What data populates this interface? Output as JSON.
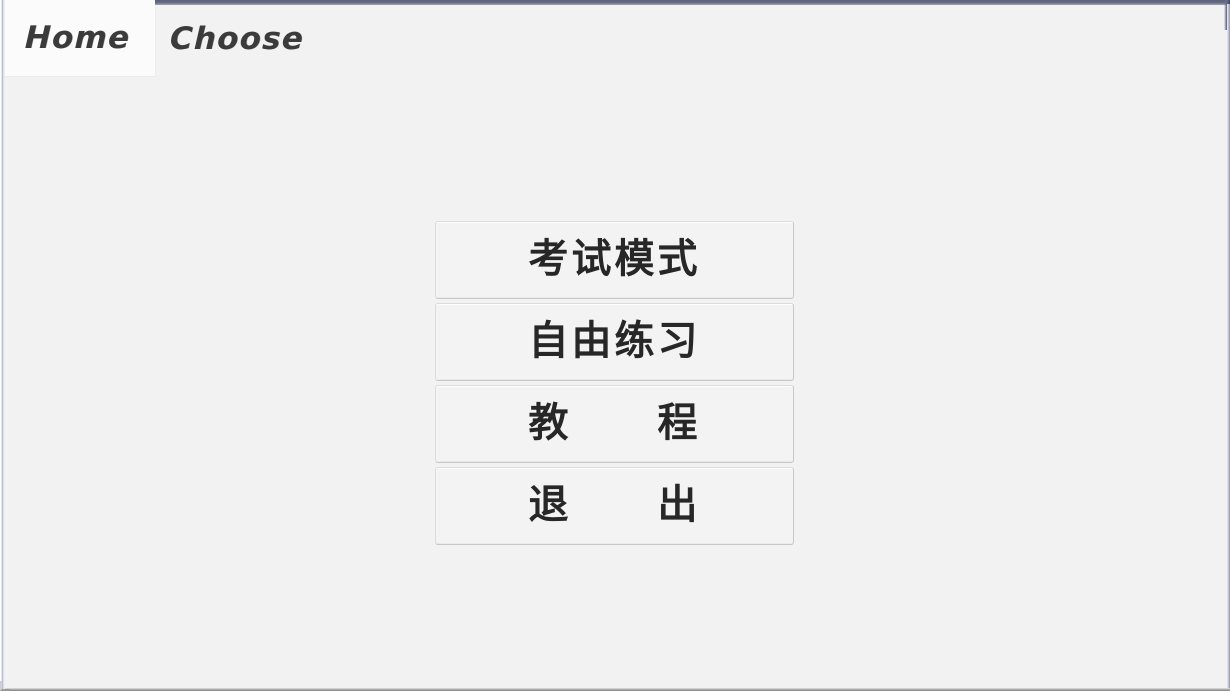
{
  "window": {
    "background_color": "#f2f2f2",
    "frame_top_color": "#676b85",
    "frame_left_color": "#a7a7c8",
    "frame_bottom_color": "#7d7d7d"
  },
  "tabs": {
    "items": [
      {
        "id": "home",
        "label": "Home",
        "active": true
      },
      {
        "id": "choose",
        "label": "Choose",
        "active": false
      }
    ],
    "active_background": "#fbfbfb"
  },
  "main_menu": {
    "buttons": [
      {
        "id": "exam-mode",
        "label": "考试模式"
      },
      {
        "id": "free-practice",
        "label": "自由练习"
      },
      {
        "id": "tutorial",
        "label": "教　　程"
      },
      {
        "id": "exit",
        "label": "退　　出"
      }
    ],
    "button_background": "#f3f3f3",
    "button_border_color": "#c7c7c7",
    "text_color": "#272727"
  }
}
